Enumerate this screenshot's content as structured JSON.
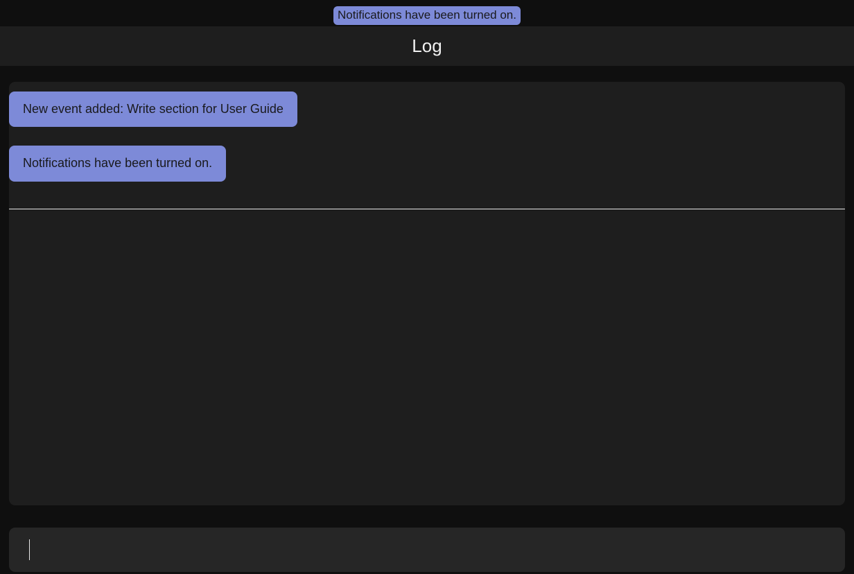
{
  "toast": {
    "message": "Notifications have been turned on."
  },
  "header": {
    "title": "Log"
  },
  "log": {
    "entries": [
      "New event added: Write section for User Guide",
      "Notifications have been turned on."
    ]
  },
  "input": {
    "value": "",
    "placeholder": ""
  }
}
